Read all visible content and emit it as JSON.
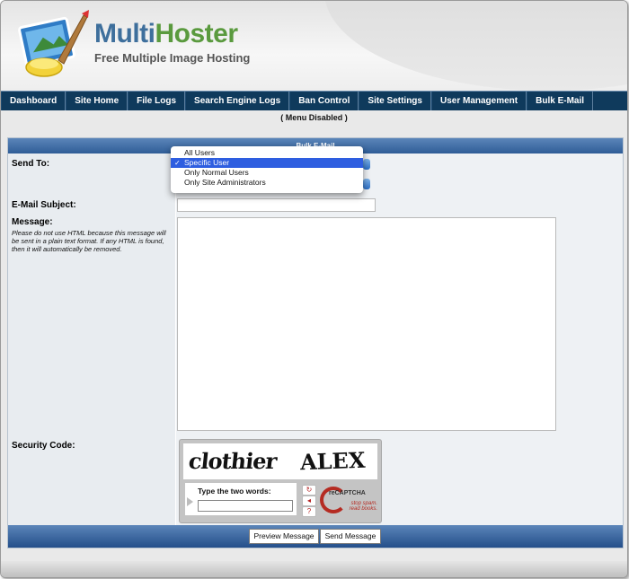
{
  "brand": {
    "name_part1": "Multi",
    "name_part2": "Hoster",
    "tagline": "Free Multiple Image Hosting",
    "logo_icon": "paint-palette-icon"
  },
  "nav": {
    "items": [
      "Dashboard",
      "Site Home",
      "File Logs",
      "Search Engine Logs",
      "Ban Control",
      "Site Settings",
      "User Management",
      "Bulk E-Mail"
    ]
  },
  "menu_status": "( Menu Disabled )",
  "form": {
    "header": "Bulk E-Mail",
    "send_to_label": "Send To:",
    "send_to_options": [
      "All Users",
      "Specific User",
      "Only Normal Users",
      "Only Site Administrators"
    ],
    "send_to_selected": "Specific User",
    "subject_label": "E-Mail Subject:",
    "subject_value": "",
    "message_label": "Message:",
    "message_hint": "Please do not use HTML because this message will be sent in a plain text format. If any HTML is found, then it will automatically be removed.",
    "message_value": "",
    "security_label": "Security Code:"
  },
  "captcha": {
    "word1": "clothier",
    "word2": "ALEX",
    "prompt": "Type the two words:",
    "brand": "reCAPTCHA",
    "tagline_line1": "stop spam.",
    "tagline_line2": "read books."
  },
  "buttons": {
    "preview": "Preview Message",
    "send": "Send Message"
  },
  "colors": {
    "nav_bg": "#0f3a5c",
    "panel_header": "#2f5d97",
    "brand_blue": "#3e6f9c",
    "brand_green": "#5a9a3e",
    "selection": "#2e5ee0"
  }
}
